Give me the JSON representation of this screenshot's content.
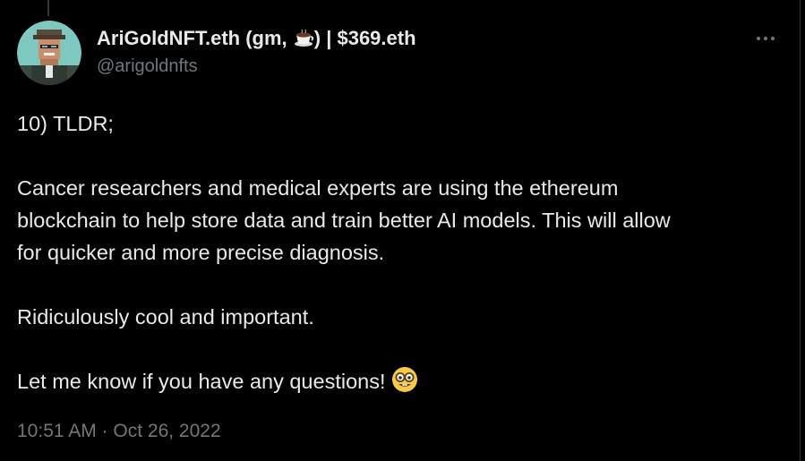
{
  "author": {
    "display_name_part1": "AriGoldNFT.eth (gm, ",
    "display_name_part2": ") | $369.eth",
    "handle": "@arigoldnfts",
    "name_emoji_icon": "coffee-cup-icon",
    "avatar_icon": "pixel-avatar-icon"
  },
  "tweet": {
    "heading": "10) TLDR;",
    "paragraph_1_line_1": "Cancer researchers and medical experts are using the ethereum",
    "paragraph_1_line_2": "blockchain to help store data and train better AI models. This will allow",
    "paragraph_1_line_3": "for quicker and more precise diagnosis.",
    "paragraph_2": "Ridiculously cool and important.",
    "paragraph_3": "Let me know if you have any questions!",
    "closing_emoji_icon": "nerd-face-icon"
  },
  "meta": {
    "timestamp": "10:51 AM · Oct 26, 2022"
  },
  "colors": {
    "background": "#000000",
    "text": "#e7e9ea",
    "secondary_text": "#71767b"
  }
}
